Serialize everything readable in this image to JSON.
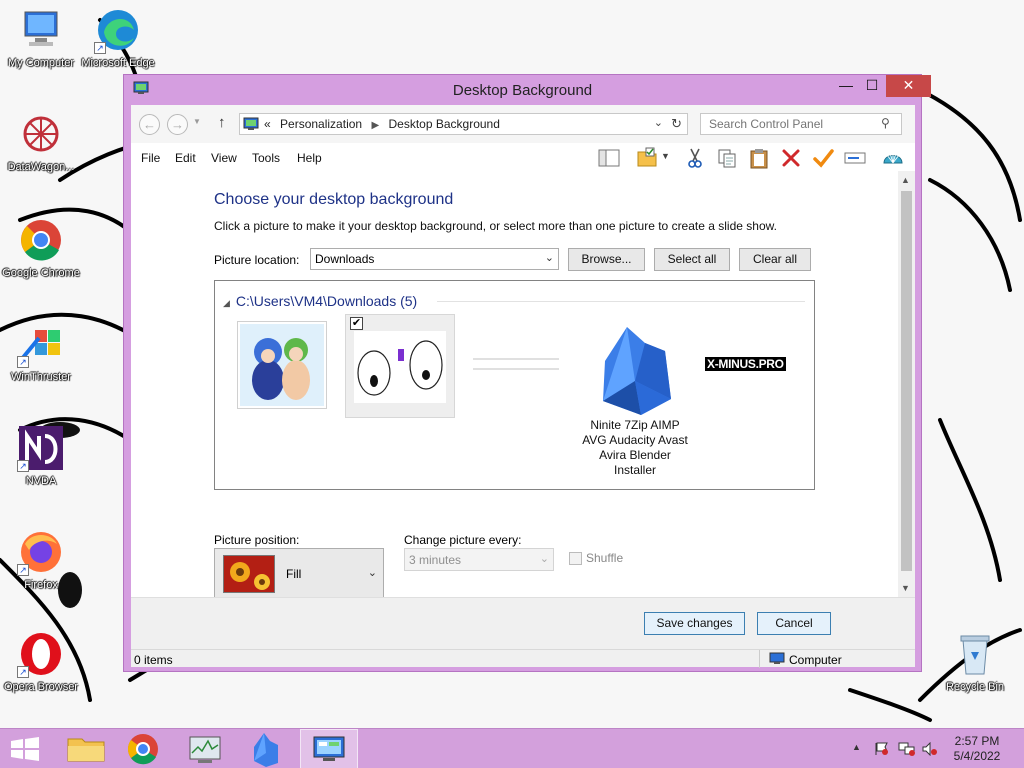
{
  "desktop": {
    "icons": [
      {
        "label": "My Computer"
      },
      {
        "label": "Microsoft Edge"
      },
      {
        "label": "DataWagon..."
      },
      {
        "label": "Google Chrome"
      },
      {
        "label": "WinThruster"
      },
      {
        "label": "NVDA"
      },
      {
        "label": "Firefox"
      },
      {
        "label": "Opera Browser"
      },
      {
        "label": "Recycle Bin"
      }
    ]
  },
  "window": {
    "title": "Desktop Background",
    "controls": {
      "minimize": "—",
      "maximize": "☐",
      "close": "✕"
    }
  },
  "address": {
    "prefix": "«",
    "crumbs": [
      "Personalization",
      "Desktop Background"
    ],
    "search_placeholder": "Search Control Panel"
  },
  "menu": [
    "File",
    "Edit",
    "View",
    "Tools",
    "Help"
  ],
  "content": {
    "heading": "Choose your desktop background",
    "subtext": "Click a picture to make it your desktop background, or select more than one picture to create a slide show.",
    "picture_location_label": "Picture location:",
    "picture_location_value": "Downloads",
    "browse_label": "Browse...",
    "select_all_label": "Select all",
    "clear_all_label": "Clear all",
    "folder_header": "C:\\Users\\VM4\\Downloads (5)",
    "thumbnail_caption": "Ninite 7Zip AIMP AVG Audacity Avast Avira Blender Installer",
    "thumbnail_text_logo": "X-MINUS.PRO",
    "picture_position_label": "Picture position:",
    "picture_position_value": "Fill",
    "change_every_label": "Change picture every:",
    "change_every_value": "3 minutes",
    "shuffle_label": "Shuffle"
  },
  "footer": {
    "save_label": "Save changes",
    "cancel_label": "Cancel"
  },
  "statusbar": {
    "items": "0 items",
    "location": "Computer"
  },
  "taskbar": {
    "time": "2:57 PM",
    "date": "5/4/2022"
  },
  "colors": {
    "window_frame": "#d59ee0",
    "heading": "#1e3287",
    "close_button": "#c74848",
    "taskbar": "#d3a0dc"
  }
}
